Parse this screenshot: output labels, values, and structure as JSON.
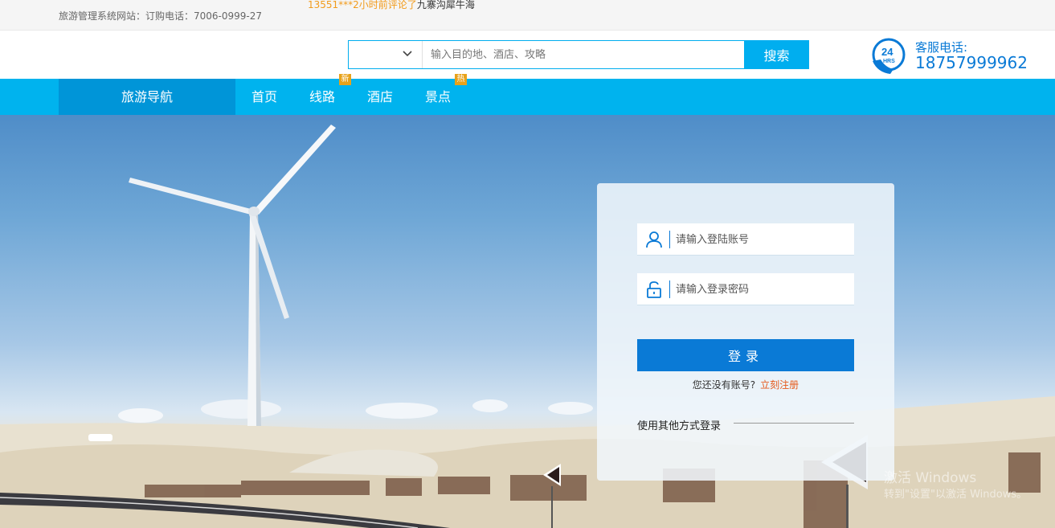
{
  "topbar": {
    "site_info": "旅游管理系统网站：订购电话：7006-0999-27",
    "ticker_who": "13551***2小时前评论了",
    "ticker_what": "九寨沟犀牛海"
  },
  "search": {
    "placeholder": "输入目的地、酒店、攻略",
    "button": "搜索"
  },
  "hotline": {
    "label": "客服电话:",
    "number": "18757999962",
    "badge_hours": "24",
    "badge_unit": "HRS"
  },
  "nav": {
    "home_block": "旅游导航",
    "items": [
      {
        "label": "首页",
        "badge": ""
      },
      {
        "label": "线路",
        "badge": "新"
      },
      {
        "label": "酒店",
        "badge": ""
      },
      {
        "label": "景点",
        "badge": "热"
      }
    ]
  },
  "login": {
    "username_placeholder": "请输入登陆账号",
    "password_placeholder": "请输入登录密码",
    "submit": "登录",
    "no_account": "您还没有账号?",
    "register": "立刻注册",
    "other_login": "使用其他方式登录"
  },
  "watermark": {
    "line1": "激活 Windows",
    "line2": "转到\"设置\"以激活 Windows。"
  },
  "colors": {
    "primary_blue": "#00b3ee",
    "dark_blue": "#0095d8",
    "accent_orange": "#e55a1c"
  }
}
